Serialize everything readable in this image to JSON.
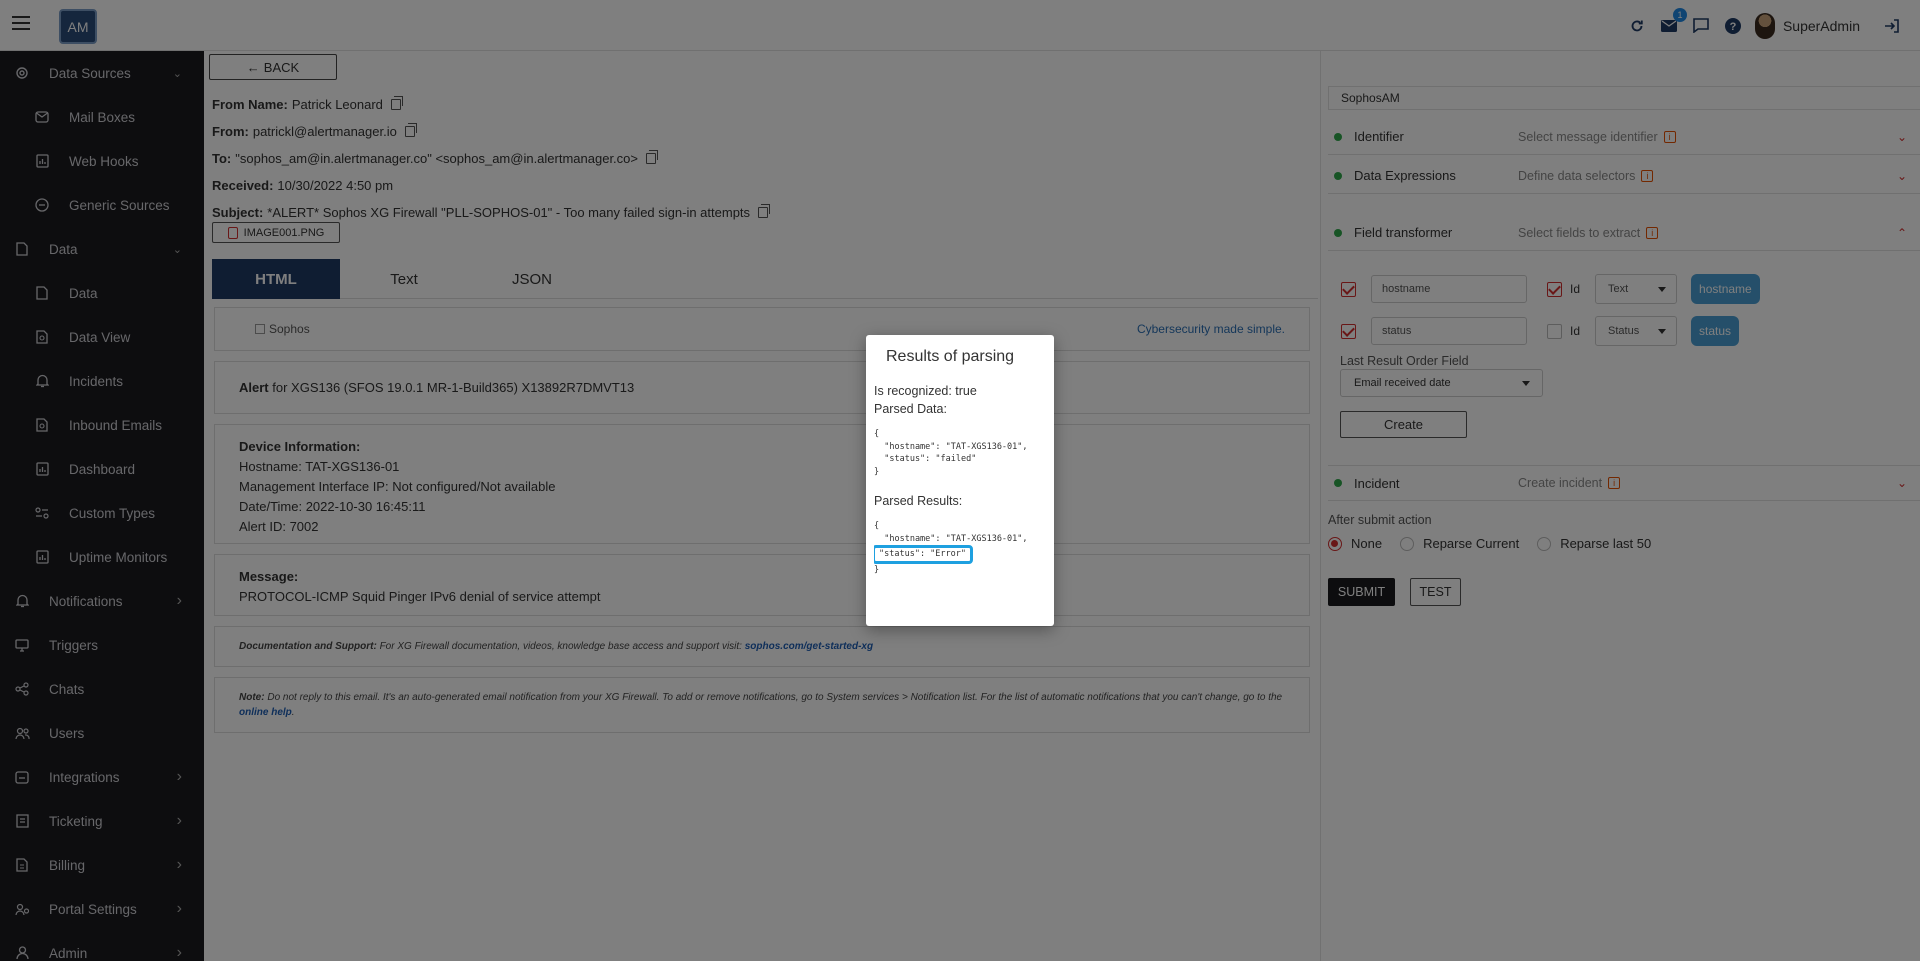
{
  "topbar": {
    "logo": "AM",
    "mail_badge": "1",
    "user_name": "SuperAdmin"
  },
  "sidebar": {
    "items": [
      {
        "label": "Data Sources",
        "icon": "gear-icon",
        "sub": false,
        "chev": "v"
      },
      {
        "label": "Mail Boxes",
        "icon": "mail-icon",
        "sub": true
      },
      {
        "label": "Web Hooks",
        "icon": "chart-icon",
        "sub": true
      },
      {
        "label": "Generic Sources",
        "icon": "circle-minus-icon",
        "sub": true
      },
      {
        "label": "Data",
        "icon": "file-icon",
        "sub": false,
        "chev": "v"
      },
      {
        "label": "Data",
        "icon": "file-icon",
        "sub": true
      },
      {
        "label": "Data View",
        "icon": "file-search-icon",
        "sub": true
      },
      {
        "label": "Incidents",
        "icon": "bell-icon",
        "sub": true
      },
      {
        "label": "Inbound Emails",
        "icon": "file-mail-icon",
        "sub": true
      },
      {
        "label": "Dashboard",
        "icon": "chart-icon",
        "sub": true
      },
      {
        "label": "Custom Types",
        "icon": "types-icon",
        "sub": true
      },
      {
        "label": "Uptime Monitors",
        "icon": "chart-icon",
        "sub": true
      },
      {
        "label": "Notifications",
        "icon": "bell-icon",
        "sub": false,
        "chev": ">"
      },
      {
        "label": "Triggers",
        "icon": "monitor-icon",
        "sub": false
      },
      {
        "label": "Chats",
        "icon": "share-icon",
        "sub": false
      },
      {
        "label": "Users",
        "icon": "users-icon",
        "sub": false
      },
      {
        "label": "Integrations",
        "icon": "integrations-icon",
        "sub": false,
        "chev": ">"
      },
      {
        "label": "Ticketing",
        "icon": "ticket-icon",
        "sub": false,
        "chev": ">"
      },
      {
        "label": "Billing",
        "icon": "billing-icon",
        "sub": false,
        "chev": ">"
      },
      {
        "label": "Portal Settings",
        "icon": "settings-icon",
        "sub": false,
        "chev": ">"
      },
      {
        "label": "Admin",
        "icon": "user-icon",
        "sub": false,
        "chev": ">"
      }
    ]
  },
  "main": {
    "back_label": "BACK",
    "from_name_label": "From Name:",
    "from_name": "Patrick Leonard",
    "from_label": "From:",
    "from": "patrickl@alertmanager.io",
    "to_label": "To:",
    "to": "\"sophos_am@in.alertmanager.co\" <sophos_am@in.alertmanager.co>",
    "received_label": "Received:",
    "received": "10/30/2022 4:50 pm",
    "subject_label": "Subject:",
    "subject": "*ALERT* Sophos XG Firewall \"PLL-SOPHOS-01\" - Too many failed sign-in attempts",
    "attachment": "IMAGE001.PNG",
    "tabs": [
      "HTML",
      "Text",
      "JSON"
    ],
    "active_tab": "HTML"
  },
  "email": {
    "logo_alt": "Sophos",
    "tagline": "Cybersecurity made simple.",
    "alert_label": "Alert",
    "alert_text": "for XGS136 (SFOS 19.0.1 MR-1-Build365) X13892R7DMVT13",
    "device_title": "Device Information:",
    "device_lines": [
      "Hostname: TAT-XGS136-01",
      "Management Interface IP: Not configured/Not available",
      "Date/Time: 2022-10-30 16:45:11",
      "Alert ID: 7002"
    ],
    "message_title": "Message:",
    "message": "PROTOCOL-ICMP Squid Pinger IPv6 denial of service attempt",
    "doc_label": "Documentation and Support:",
    "doc_text": "For XG Firewall documentation, videos, knowledge base access and support visit:",
    "doc_link": "sophos.com/get-started-xg",
    "note_label": "Note:",
    "note_text": "Do not reply to this email. It's an auto-generated email notification from your XG Firewall. To add or remove notifications, go to System services > Notification list. For the list of automatic notifications that you can't change, go to the",
    "note_link": "online help",
    "note_end": "."
  },
  "right_panel": {
    "title": "SophosAM",
    "sections": [
      {
        "title": "Identifier",
        "desc": "Select message identifier"
      },
      {
        "title": "Data Expressions",
        "desc": "Define data selectors"
      },
      {
        "title": "Field transformer",
        "desc": "Select fields to extract"
      },
      {
        "title": "Incident",
        "desc": "Create incident"
      }
    ],
    "fields": [
      {
        "name": "hostname",
        "id_label": "Id",
        "type": "Text",
        "chip": "hostname"
      },
      {
        "name": "status",
        "id_label": "Id",
        "type": "Status",
        "chip": "status"
      }
    ],
    "last_result_label": "Last Result Order Field",
    "last_result_value": "Email received date",
    "create_label": "Create",
    "after_submit_label": "After submit action",
    "radio_options": [
      "None",
      "Reparse Current",
      "Reparse last 50"
    ],
    "radio_selected": "None",
    "submit_label": "SUBMIT",
    "test_label": "TEST"
  },
  "dialog": {
    "title": "Results of parsing",
    "recognized": "Is recognized: true",
    "parsed_data_label": "Parsed Data:",
    "parsed_data_open": "{",
    "parsed_data_line1": "  \"hostname\": \"TAT-XGS136-01\",",
    "parsed_data_line2": "  \"status\": \"failed\"",
    "parsed_data_close": "}",
    "parsed_results_label": "Parsed Results:",
    "parsed_results_open": "{",
    "parsed_results_line1": "  \"hostname\": \"TAT-XGS136-01\",",
    "parsed_results_line2": "\"status\": \"Error\"",
    "parsed_results_close": "}"
  }
}
